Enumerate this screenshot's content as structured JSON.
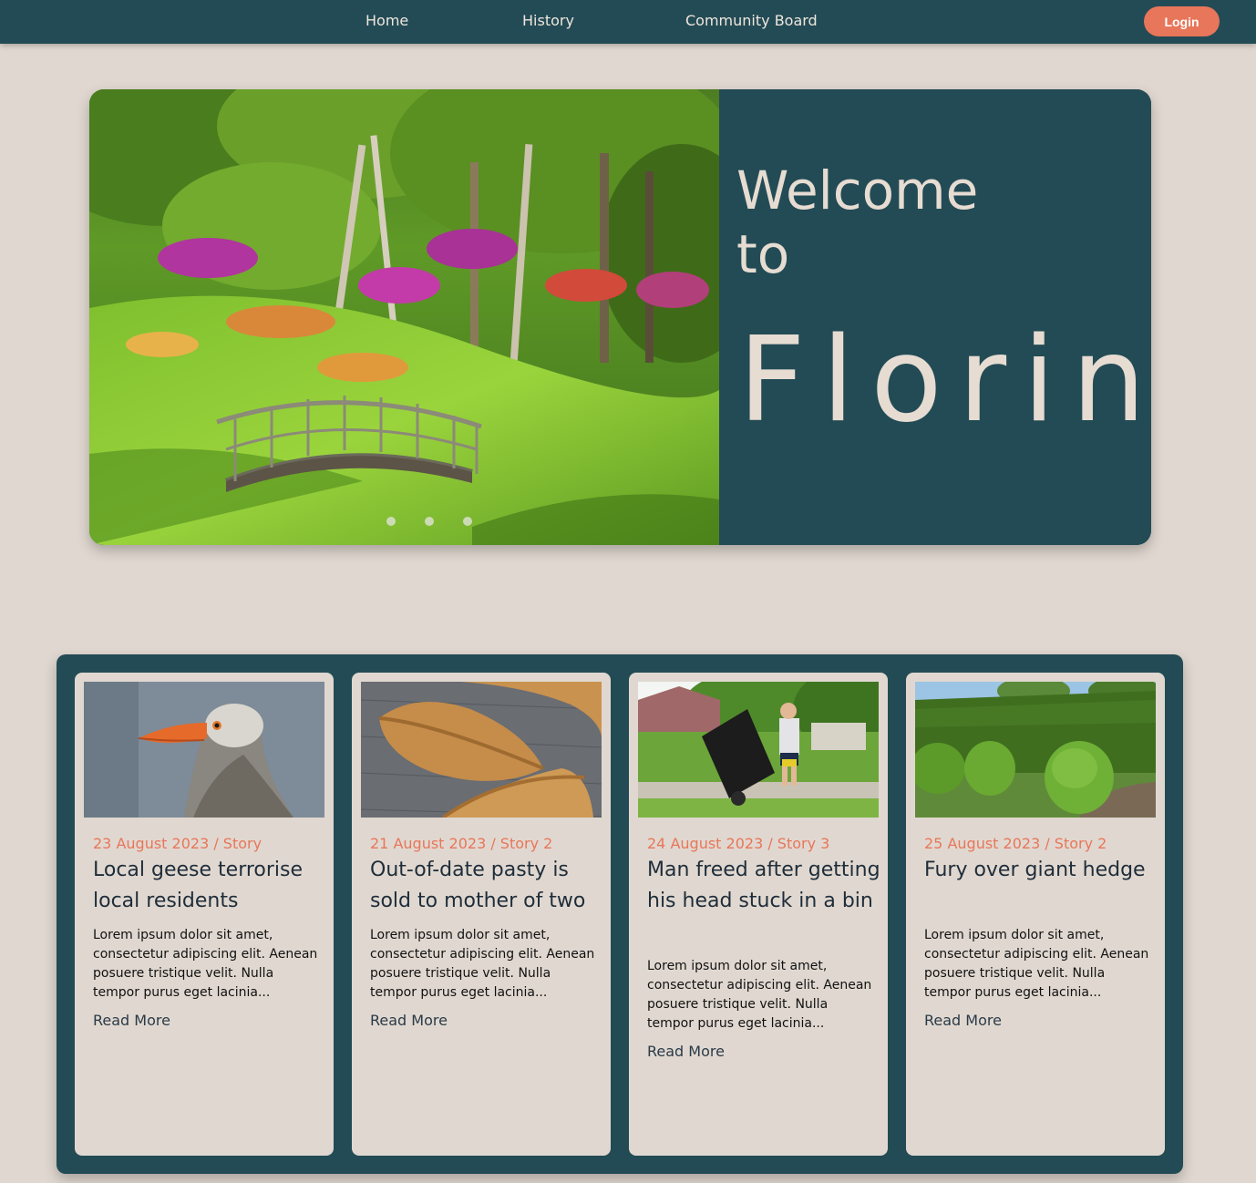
{
  "nav": {
    "links": [
      "Home",
      "History",
      "Community Board"
    ],
    "login_label": "Login"
  },
  "hero": {
    "welcome": "Welcome to",
    "brand": "Florin",
    "dots": 3
  },
  "news": [
    {
      "date": "23 August 2023 / Story",
      "title": "Local geese terrorise local residents",
      "body": "Lorem ipsum dolor sit amet, consectetur adipiscing elit. Aenean posuere tristique velit. Nulla tempor purus eget lacinia...",
      "more": "Read More"
    },
    {
      "date": "21 August 2023 / Story 2",
      "title": "Out-of-date pasty is sold to mother of two",
      "body": "Lorem ipsum dolor sit amet, consectetur adipiscing elit. Aenean posuere tristique velit. Nulla tempor purus eget lacinia...",
      "more": "Read More"
    },
    {
      "date": "24 August 2023 / Story 3",
      "title": "Man freed after getting his head stuck in a bin",
      "body": "Lorem ipsum dolor sit amet, consectetur adipiscing elit. Aenean posuere tristique velit. Nulla tempor purus eget lacinia...",
      "more": "Read More"
    },
    {
      "date": "25 August 2023 / Story 2",
      "title": "Fury over giant hedge",
      "body": "Lorem ipsum dolor sit amet, consectetur adipiscing elit. Aenean posuere tristique velit. Nulla tempor purus eget lacinia...",
      "more": "Read More"
    }
  ],
  "colors": {
    "teal": "#234b55",
    "accent": "#e8765a",
    "background": "#e0d8d0"
  }
}
